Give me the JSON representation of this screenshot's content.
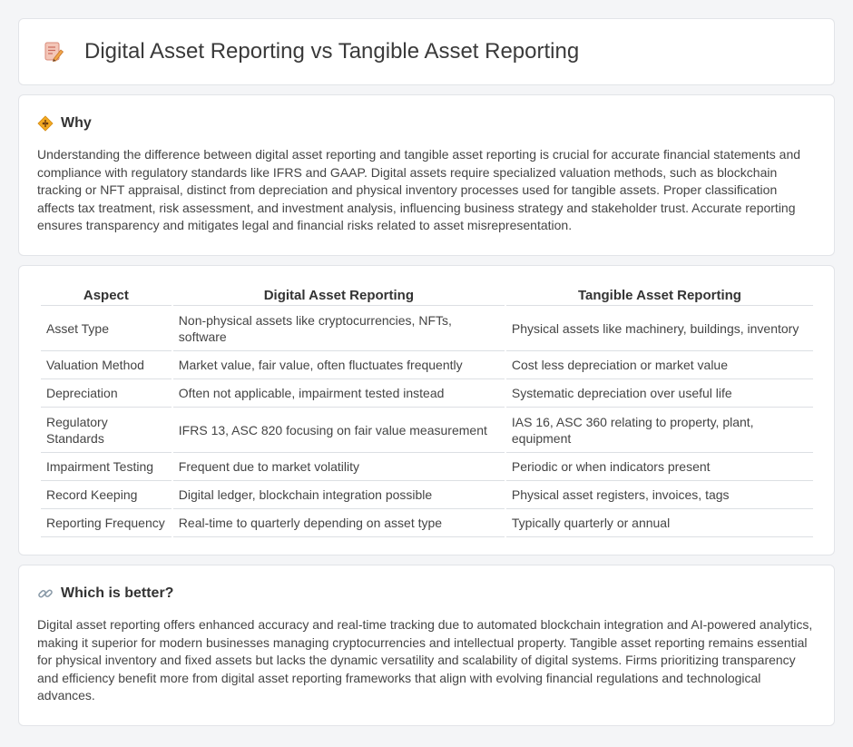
{
  "header": {
    "title": "Digital Asset Reporting vs Tangible Asset Reporting",
    "icon": "document-pencil-icon"
  },
  "why": {
    "title": "Why",
    "icon": "diamond-signal-icon",
    "text": "Understanding the difference between digital asset reporting and tangible asset reporting is crucial for accurate financial statements and compliance with regulatory standards like IFRS and GAAP. Digital assets require specialized valuation methods, such as blockchain tracking or NFT appraisal, distinct from depreciation and physical inventory processes used for tangible assets. Proper classification affects tax treatment, risk assessment, and investment analysis, influencing business strategy and stakeholder trust. Accurate reporting ensures transparency and mitigates legal and financial risks related to asset misrepresentation."
  },
  "table": {
    "headers": [
      "Aspect",
      "Digital Asset Reporting",
      "Tangible Asset Reporting"
    ],
    "rows": [
      [
        "Asset Type",
        "Non-physical assets like cryptocurrencies, NFTs, software",
        "Physical assets like machinery, buildings, inventory"
      ],
      [
        "Valuation Method",
        "Market value, fair value, often fluctuates frequently",
        "Cost less depreciation or market value"
      ],
      [
        "Depreciation",
        "Often not applicable, impairment tested instead",
        "Systematic depreciation over useful life"
      ],
      [
        "Regulatory Standards",
        "IFRS 13, ASC 820 focusing on fair value measurement",
        "IAS 16, ASC 360 relating to property, plant, equipment"
      ],
      [
        "Impairment Testing",
        "Frequent due to market volatility",
        "Periodic or when indicators present"
      ],
      [
        "Record Keeping",
        "Digital ledger, blockchain integration possible",
        "Physical asset registers, invoices, tags"
      ],
      [
        "Reporting Frequency",
        "Real-time to quarterly depending on asset type",
        "Typically quarterly or annual"
      ]
    ]
  },
  "better": {
    "title": "Which is better?",
    "icon": "link-icon",
    "text": "Digital asset reporting offers enhanced accuracy and real-time tracking due to automated blockchain integration and AI-powered analytics, making it superior for modern businesses managing cryptocurrencies and intellectual property. Tangible asset reporting remains essential for physical inventory and fixed assets but lacks the dynamic versatility and scalability of digital systems. Firms prioritizing transparency and efficiency benefit more from digital asset reporting frameworks that align with evolving financial regulations and technological advances."
  }
}
